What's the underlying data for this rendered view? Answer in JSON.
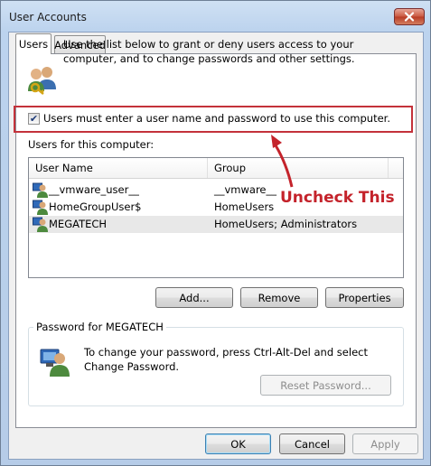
{
  "window": {
    "title": "User Accounts"
  },
  "tabs": [
    {
      "label": "Users",
      "active": true
    },
    {
      "label": "Advanced",
      "active": false
    }
  ],
  "intro_text": "Use the list below to grant or deny users access to your computer, and to change passwords and other settings.",
  "require_login": {
    "checked": true,
    "label": "Users must enter a user name and password to use this computer."
  },
  "users_section_label": "Users for this computer:",
  "users_table": {
    "columns": [
      "User Name",
      "Group"
    ],
    "rows": [
      {
        "name": "__vmware_user__",
        "group": "__vmware__",
        "selected": false
      },
      {
        "name": "HomeGroupUser$",
        "group": "HomeUsers",
        "selected": false
      },
      {
        "name": "MEGATECH",
        "group": "HomeUsers; Administrators",
        "selected": true
      }
    ]
  },
  "user_buttons": {
    "add": "Add...",
    "remove": "Remove",
    "properties": "Properties"
  },
  "password_group": {
    "title": "Password for MEGATECH",
    "text": "To change your password, press Ctrl-Alt-Del and select Change Password.",
    "reset_button": "Reset Password..."
  },
  "dialog_buttons": {
    "ok": "OK",
    "cancel": "Cancel",
    "apply": "Apply"
  },
  "annotation": {
    "text": "Uncheck This",
    "color": "#c4232b"
  },
  "icons": {
    "users": "users-key-icon",
    "user": "user-icon",
    "password_user": "user-monitor-icon",
    "close": "close-icon",
    "checkmark": "checkmark-icon",
    "arrow": "arrow-icon"
  }
}
